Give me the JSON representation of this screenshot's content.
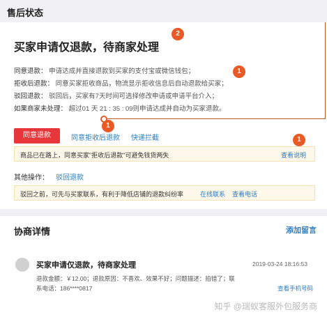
{
  "section_status": {
    "title": "售后状态"
  },
  "status": {
    "headline": "买家申请仅退款，待商家处理",
    "lines": [
      {
        "key": "同意退款：",
        "value": "申请达成并直接退款到买家的支付宝或微信钱包；"
      },
      {
        "key": "拒收后退款：",
        "value": "同意买家拒收商品，物流显示拒收信息后自动退款给买家；"
      },
      {
        "key": "驳回退款：",
        "value": "驳回后，买家有7天时间可选择修改申请或申请平台介入；"
      },
      {
        "key": "如果商家未处理：",
        "value": "超过01 天 21 : 35 : 09则申请达成并自动为买家退款。"
      }
    ],
    "actions": {
      "agree_refund": "同意退款",
      "agree_after_reject": "同意拒收后退款",
      "quick_intercept": "快递拦截"
    },
    "notice1": {
      "text": "商品已在路上，同意买家\"拒收后退款\"可避免钱货两失",
      "link": "查看说明"
    },
    "other_ops": {
      "label": "其他操作：",
      "link": "驳回退款"
    },
    "notice2": {
      "text": "驳回之前，可先与买家联系，有利于降低店铺的退款纠纷率",
      "link_online": "在线联系",
      "link_phone": "查看电话"
    },
    "badges": {
      "b1": "2",
      "b2": "1",
      "b3": "1",
      "b4": "1"
    }
  },
  "detail": {
    "header": {
      "title": "协商详情",
      "add_message": "添加留言"
    },
    "entry": {
      "title": "买家申请仅退款，待商家处理",
      "time": "2019-03-24 18:16:53",
      "line1": "退款金额：￥12.00；退款原因：不喜欢、效果不好；问题描述：拍错了；联",
      "line2": "系电话：186****0817",
      "phone_link": "查看手机号码"
    }
  },
  "watermark": "知乎 @瑞蚁客服外包服务商",
  "colors": {
    "accent_red": "#e8363a",
    "badge_orange": "#ea5a26",
    "link_blue": "#2f7ec2",
    "notice_bg": "#fdf8ea"
  }
}
